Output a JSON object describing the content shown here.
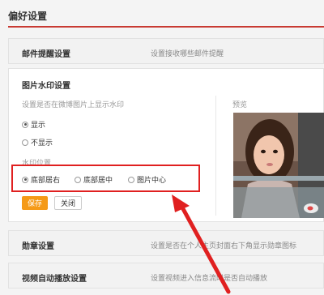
{
  "page": {
    "title": "偏好设置"
  },
  "email_section": {
    "label": "邮件提醒设置",
    "desc": "设置接收哪些邮件提醒"
  },
  "watermark_section": {
    "title": "图片水印设置",
    "desc": "设置是否在微博图片上显示水印",
    "show_label": "显示",
    "hide_label": "不显示",
    "position_label": "水印位置",
    "positions": [
      "底部居右",
      "底部居中",
      "图片中心"
    ],
    "selected_position": "底部居右",
    "save_label": "保存",
    "close_label": "关闭",
    "preview_label": "预览"
  },
  "badge_section": {
    "label": "勋章设置",
    "desc": "设置是否在个人主页封面右下角显示勋章图标"
  },
  "video_section": {
    "label": "视频自动播放设置",
    "desc": "设置视频进入信息流时是否自动播放"
  },
  "colors": {
    "accent": "#c83a32",
    "save": "#f59a17",
    "highlight": "#e02020"
  }
}
